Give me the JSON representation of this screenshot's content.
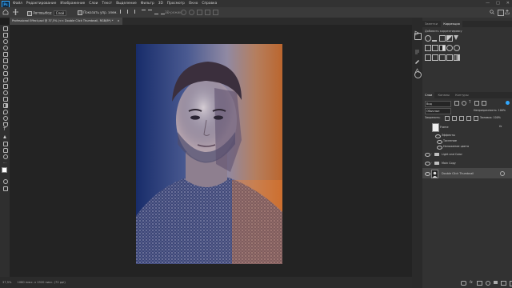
{
  "app": {
    "logo": "Ps"
  },
  "menu": [
    "Файл",
    "Редактирование",
    "Изображение",
    "Слои",
    "Текст",
    "Выделение",
    "Фильтр",
    "3D",
    "Просмотр",
    "Окно",
    "Справка"
  ],
  "window_controls": {
    "minimize": "—",
    "maximize": "□",
    "close": "✕"
  },
  "options": {
    "auto_select_label": "Автовыбор:",
    "auto_select_value": "Слой",
    "show_controls_label": "Показать упр. элем.",
    "mode_3d": "3D-режим:"
  },
  "document_tab": {
    "title": "Professional Effect.psd @ 37,5% (<< Double Click Thumbnail, RGB/8*) *",
    "close": "×"
  },
  "status": {
    "zoom": "37,5%",
    "doc_info": "1080 пикс. x 1920 пикс. (72 ppi)"
  },
  "panel_top": {
    "tabs": [
      "Заметки",
      "Коррекция"
    ],
    "title": "Добавить корректировку"
  },
  "layers_panel": {
    "tabs": [
      "Слои",
      "Каналы",
      "Контуры"
    ],
    "filter_label": "Вид",
    "blend_mode": "Обычные",
    "opacity_label": "Непрозрачность:",
    "opacity_value": "100%",
    "lock_label": "Закрепить:",
    "fill_label": "Заливка:",
    "fill_value": "100%",
    "layers": [
      {
        "name": "Frame",
        "type": "layer",
        "fx": "fx"
      },
      {
        "name": "Эффекты",
        "type": "effects"
      },
      {
        "name": "Тиснение",
        "type": "effect"
      },
      {
        "name": "Наложение цвета",
        "type": "effect"
      },
      {
        "name": "Light and Color",
        "type": "group"
      },
      {
        "name": "Main Copy",
        "type": "group"
      },
      {
        "name": "Double Click Thumbnail",
        "type": "smart",
        "selected": true
      }
    ]
  },
  "colors": {
    "photo_left": "#1d3a78",
    "photo_right": "#f07a1a",
    "accent": "#31a8ff"
  }
}
